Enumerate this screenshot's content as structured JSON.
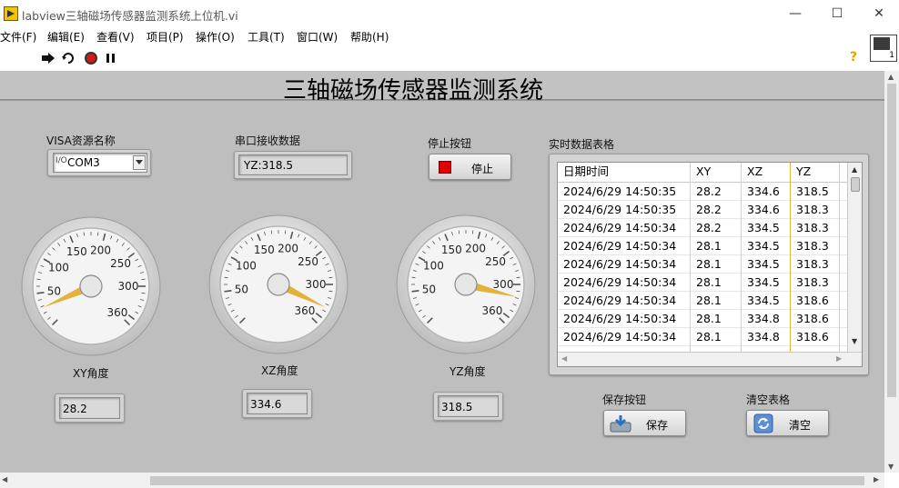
{
  "window": {
    "title": "labview三轴磁场传感器监测系统上位机.vi",
    "minimize": "—",
    "maximize": "☐",
    "close": "✕"
  },
  "menu": [
    "文件(F)",
    "编辑(E)",
    "查看(V)",
    "项目(P)",
    "操作(O)",
    "工具(T)",
    "窗口(W)",
    "帮助(H)"
  ],
  "toolbar": {
    "icons": [
      "run-icon",
      "run-continuously-icon",
      "abort-icon",
      "pause-icon"
    ],
    "help": "?",
    "vi_icon_number": "1"
  },
  "panel": {
    "main_title": "三轴磁场传感器监测系统",
    "visa": {
      "label": "VISA资源名称",
      "prefix": "I/O",
      "value": "COM3"
    },
    "serial": {
      "label": "串口接收数据",
      "value": "YZ:318.5"
    },
    "stop": {
      "label": "停止按钮",
      "button": "停止",
      "led_color": "#e00000"
    },
    "table_label": "实时数据表格",
    "save": {
      "label": "保存按钮",
      "button": "保存"
    },
    "clear": {
      "label": "清空表格",
      "button": "清空"
    }
  },
  "gauges": [
    {
      "name": "XY角度",
      "value": 28.2,
      "display": "28.2"
    },
    {
      "name": "XZ角度",
      "value": 334.6,
      "display": "334.6"
    },
    {
      "name": "YZ角度",
      "value": 318.5,
      "display": "318.5"
    }
  ],
  "gauge_scale": {
    "min": 0,
    "max": 360,
    "ticks": [
      "50",
      "100",
      "150",
      "200",
      "250",
      "300",
      "360"
    ],
    "needle_color": "#e2b23c"
  },
  "table": {
    "columns": [
      "日期时间",
      "XY",
      "XZ",
      "YZ"
    ],
    "rows": [
      [
        "2024/6/29 14:50:35",
        "28.2",
        "334.6",
        "318.5"
      ],
      [
        "2024/6/29 14:50:35",
        "28.2",
        "334.6",
        "318.3"
      ],
      [
        "2024/6/29 14:50:34",
        "28.2",
        "334.5",
        "318.3"
      ],
      [
        "2024/6/29 14:50:34",
        "28.1",
        "334.5",
        "318.3"
      ],
      [
        "2024/6/29 14:50:34",
        "28.1",
        "334.5",
        "318.3"
      ],
      [
        "2024/6/29 14:50:34",
        "28.1",
        "334.5",
        "318.3"
      ],
      [
        "2024/6/29 14:50:34",
        "28.1",
        "334.5",
        "318.6"
      ],
      [
        "2024/6/29 14:50:34",
        "28.1",
        "334.8",
        "318.6"
      ],
      [
        "2024/6/29 14:50:34",
        "28.1",
        "334.8",
        "318.6"
      ]
    ]
  }
}
